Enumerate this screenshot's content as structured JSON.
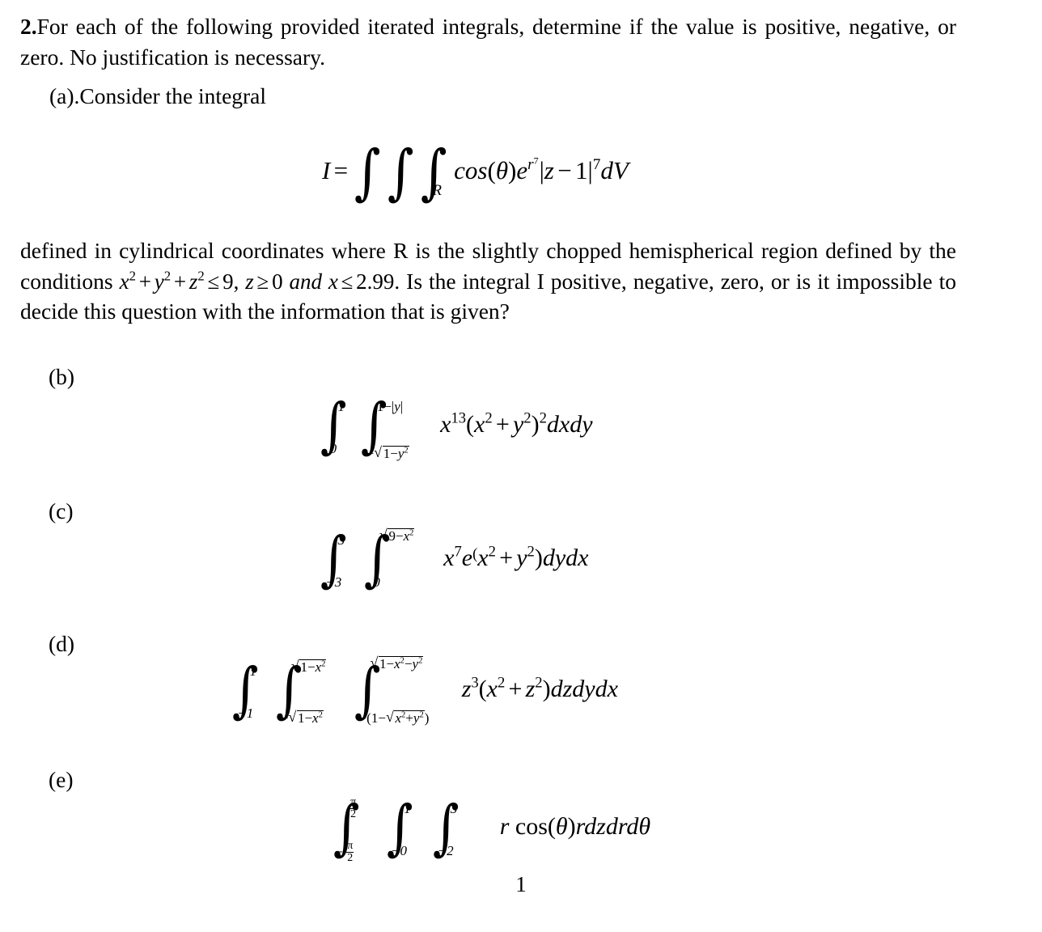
{
  "document": {
    "question_number": "2.",
    "intro_text": "For each of the following provided iterated integrals, determine if the value is positive, negative, or zero. No justification is necessary.",
    "page_number": "1"
  },
  "parts": {
    "a": {
      "label": "(a).Consider the integral",
      "formula_plain": "I = ∫∫∫_R cos(θ) e^{r^7} |z - 1|^7 dV",
      "equation": {
        "lhs": "I",
        "equals": "=",
        "integrand_prefix": "cos(θ)e",
        "exponent_base": "r",
        "exponent_power": "7",
        "abs_open": "|",
        "abs_body": "z − 1",
        "abs_close": "|",
        "abs_power": "7",
        "differential": "dV",
        "region_subscript": "R"
      },
      "description_line1": "defined in cylindrical coordinates where R is the slightly chopped hemispherical",
      "description_line2_pre": "region defined by the conditions ",
      "conditions": {
        "sphere": "x² + y² + z² ≤ 9",
        "zcond": "z ≥ 0",
        "conj": "and",
        "xcond": "x ≤ 2.99"
      },
      "description_line3": "Is the integral I positive, negative, zero, or is it impossible to decide this question with the information that is given?"
    },
    "b": {
      "label": "(b)",
      "formula_plain": "∫_0^1 ∫_{-√(1-y²)}^{1-|y|} x¹³(x² + y²)² dxdy",
      "outer_lower": "0",
      "outer_upper": "1",
      "inner_upper": "1−|y|",
      "inner_lower_radicand": "1−y",
      "integrand_var": "x",
      "integrand_power": "13",
      "group": "(x² + y²)²",
      "differential": "dxdy"
    },
    "c": {
      "label": "(c)",
      "formula_plain": "∫_{-3}^{3} ∫_0^{√(9-x²)} x⁷ e^((x² + y²) dydx",
      "outer_lower": "−3",
      "outer_upper": "3",
      "inner_lower": "0",
      "inner_upper_radicand": "9−x",
      "integrand": "x⁷e(x² + y²)",
      "differential": "dydx"
    },
    "d": {
      "label": "(d)",
      "formula_plain": "∫_{-1}^{1} ∫_{-√(1-x²)}^{√(1-x²)} ∫_{-(1-√(x²+y²))}^{√(1-x²-y²)} z³(x² + z²) dzdydx",
      "outer_lower": "−1",
      "outer_upper": "1",
      "mid_radicand": "1−x",
      "inner_upper_radicand": "1−x²−y²",
      "inner_lower_radicand": "x²+y²",
      "integrand": "z³(x² + z²)",
      "differential": "dzdydx"
    },
    "e": {
      "label": "(e)",
      "formula_plain": "∫_{-π/2}^{π/2} ∫_{-0}^{1} ∫_{-2}^{3} r cos(θ) rdzdrdθ",
      "outer_upper_num": "π",
      "outer_upper_den": "2",
      "outer_lower_sign": "−",
      "outer_lower_num": "π",
      "outer_lower_den": "2",
      "mid_lower": "−0",
      "mid_upper": "1",
      "inner_lower": "−2",
      "inner_upper": "3",
      "integrand": "r cos(θ)",
      "differential": "rdzdrdθ"
    }
  }
}
